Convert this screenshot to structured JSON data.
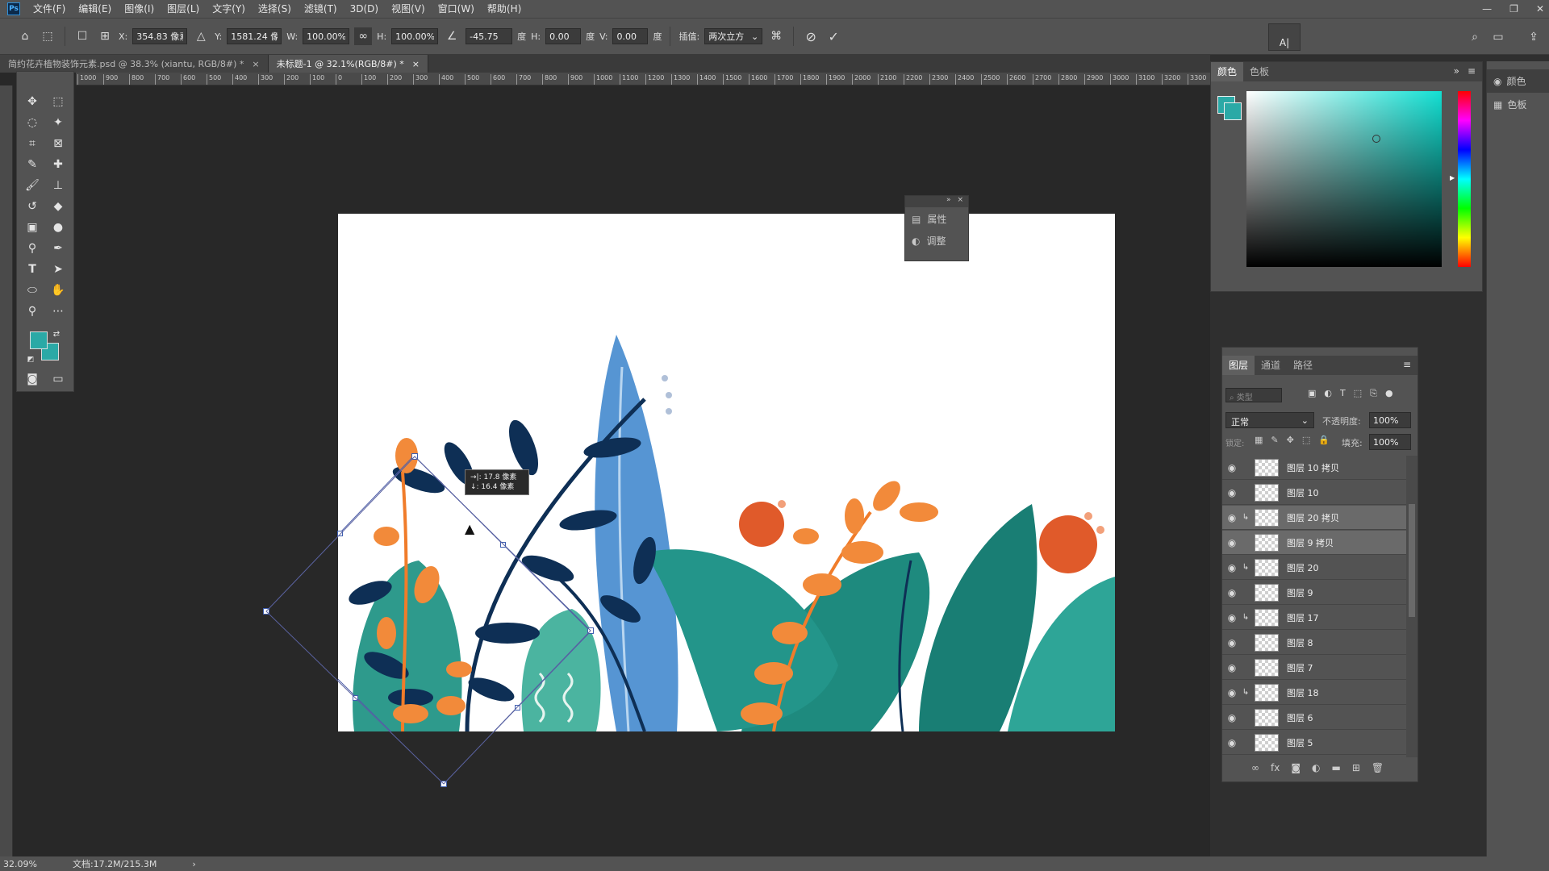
{
  "menubar": {
    "logo": "Ps",
    "items": [
      "文件(F)",
      "编辑(E)",
      "图像(I)",
      "图层(L)",
      "文字(Y)",
      "选择(S)",
      "滤镜(T)",
      "3D(D)",
      "视图(V)",
      "窗口(W)",
      "帮助(H)"
    ],
    "window_controls": [
      "—",
      "❐",
      "✕"
    ]
  },
  "options": {
    "x_label": "X:",
    "x_value": "354.83 像素",
    "y_label": "Y:",
    "y_value": "1581.24 像",
    "w_label": "W:",
    "w_value": "100.00%",
    "h_label": "H:",
    "h_value": "100.00%",
    "angle_value": "-45.75",
    "angle_unit": "度",
    "hskew_label": "H:",
    "hskew_value": "0.00",
    "hskew_unit": "度",
    "vskew_label": "V:",
    "vskew_value": "0.00",
    "vskew_unit": "度",
    "interp_label": "插值:",
    "interp_value": "两次立方"
  },
  "tabs": [
    {
      "label": "简约花卉植物装饰元素.psd @ 38.3% (xiantu, RGB/8#) *",
      "close": "×"
    },
    {
      "label": "未标题-1 @ 32.1%(RGB/8#) *",
      "close": "×"
    }
  ],
  "ruler_ticks": [
    "1000",
    "900",
    "800",
    "700",
    "600",
    "500",
    "400",
    "300",
    "200",
    "100",
    "0",
    "100",
    "200",
    "300",
    "400",
    "500",
    "600",
    "700",
    "800",
    "900",
    "1000",
    "1100",
    "1200",
    "1300",
    "1400",
    "1500",
    "1600",
    "1700",
    "1800",
    "1900",
    "2000",
    "2100",
    "2200",
    "2300",
    "2400",
    "2500",
    "2600",
    "2700",
    "2800",
    "2900",
    "3000",
    "3100",
    "3200",
    "3300"
  ],
  "colors": {
    "foreground": "#2ba9a6",
    "background": "#2ba9a6",
    "picker_hue": "#13e0d3"
  },
  "transform_tooltip": {
    "line1": "→|: 17.8 像素",
    "line2": "↓: 16.4 像素"
  },
  "float_panel": {
    "items": [
      "属性",
      "调整"
    ]
  },
  "color_panel": {
    "tabs": [
      "颜色",
      "色板"
    ]
  },
  "side_icons": {
    "items": [
      "颜色",
      "色板"
    ]
  },
  "layers_panel": {
    "tabs": [
      "图层",
      "通道",
      "路径"
    ],
    "filter_placeholder": "类型",
    "blend_mode": "正常",
    "opacity_label": "不透明度:",
    "opacity_value": "100%",
    "lock_label": "锁定:",
    "fill_label": "填充:",
    "fill_value": "100%",
    "layers": [
      {
        "name": "图层 10 拷贝",
        "clip": false,
        "selected": false
      },
      {
        "name": "图层 10",
        "clip": false,
        "selected": false
      },
      {
        "name": "图层 20 拷贝",
        "clip": true,
        "selected": true
      },
      {
        "name": "图层 9 拷贝",
        "clip": false,
        "selected": true
      },
      {
        "name": "图层 20",
        "clip": true,
        "selected": false
      },
      {
        "name": "图层 9",
        "clip": false,
        "selected": false
      },
      {
        "name": "图层 17",
        "clip": true,
        "selected": false
      },
      {
        "name": "图层 8",
        "clip": false,
        "selected": false
      },
      {
        "name": "图层 7",
        "clip": false,
        "selected": false
      },
      {
        "name": "图层 18",
        "clip": true,
        "selected": false
      },
      {
        "name": "图层 6",
        "clip": false,
        "selected": false
      },
      {
        "name": "图层 5",
        "clip": false,
        "selected": false
      }
    ]
  },
  "status": {
    "zoom": "32.09%",
    "doc": "文档:17.2M/215.3M",
    "arrow": "›"
  }
}
